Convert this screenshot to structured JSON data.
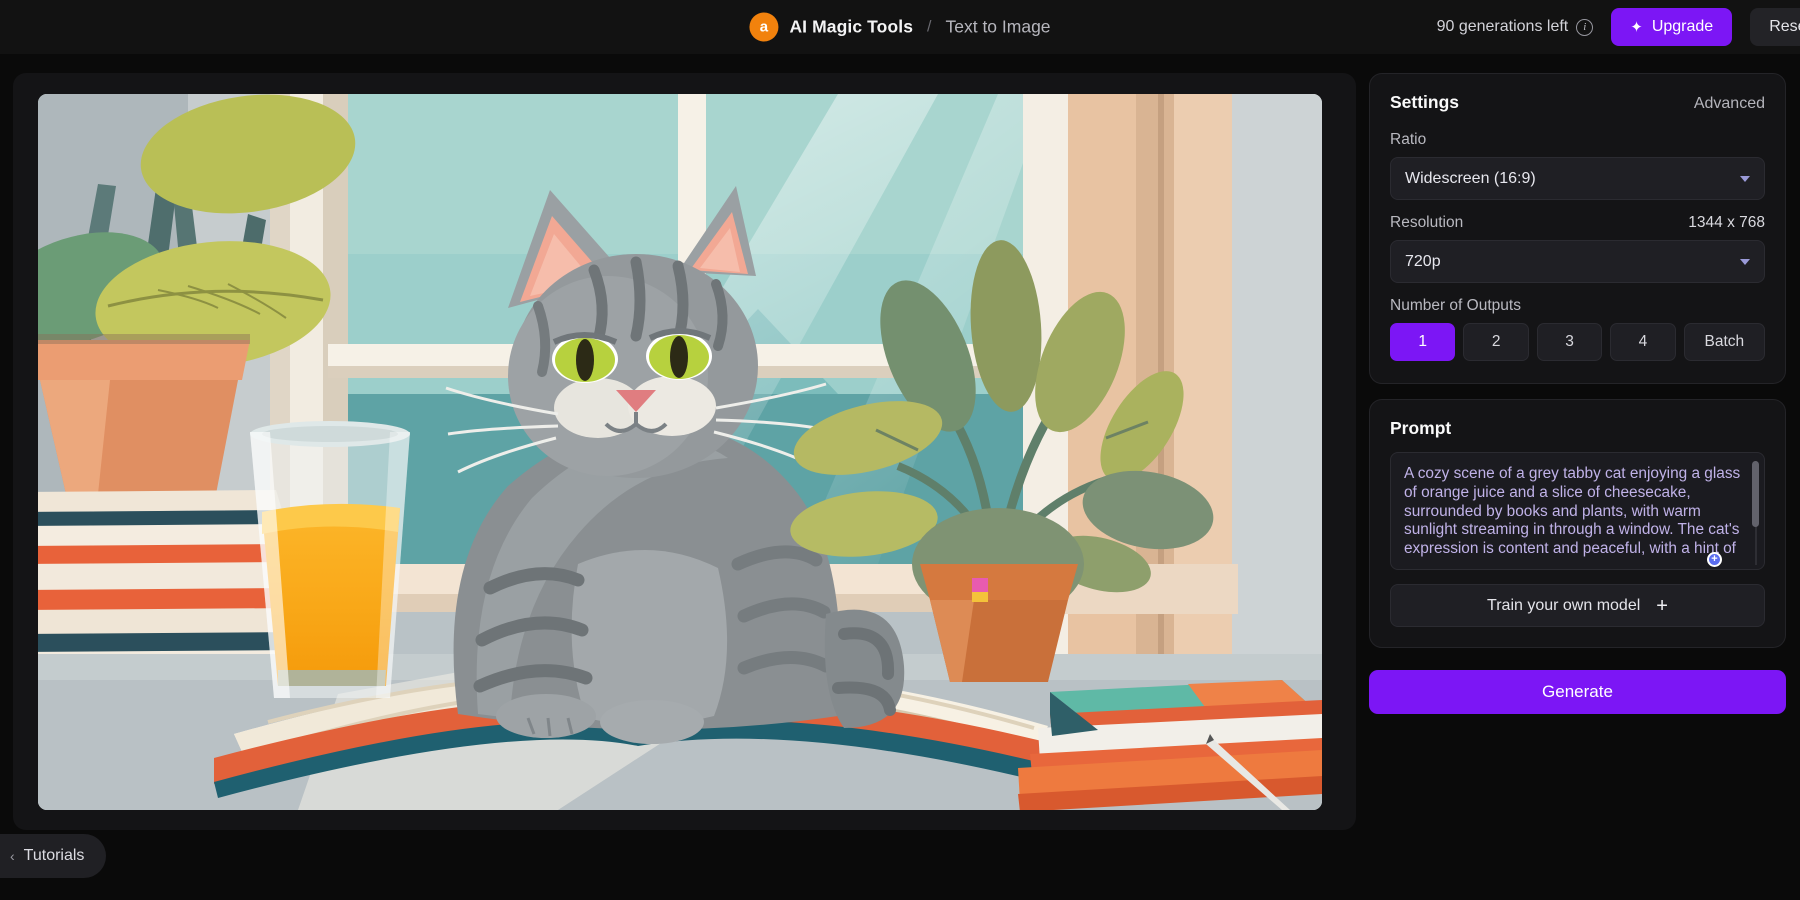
{
  "topbar": {
    "avatar_initial": "a",
    "app_title": "AI Magic Tools",
    "breadcrumb_separator": "/",
    "breadcrumb_current": "Text to Image",
    "generations_left": "90 generations left",
    "info_glyph": "i",
    "upgrade_label": "Upgrade",
    "upgrade_icon": "✦",
    "reset_label": "Reset",
    "accent_color": "#7c16f5",
    "avatar_color": "#f2820d"
  },
  "settings": {
    "title": "Settings",
    "advanced_label": "Advanced",
    "ratio_label": "Ratio",
    "ratio_value": "Widescreen (16:9)",
    "ratio_options": [
      "Widescreen (16:9)"
    ],
    "resolution_label": "Resolution",
    "resolution_dimensions": "1344 x 768",
    "resolution_value": "720p",
    "resolution_options": [
      "720p"
    ],
    "outputs_label": "Number of Outputs",
    "outputs_options": [
      "1",
      "2",
      "3",
      "4",
      "Batch"
    ],
    "outputs_selected": "1"
  },
  "prompt": {
    "title": "Prompt",
    "value": "A cozy scene of a grey tabby cat enjoying a glass of orange juice and a slice of cheesecake, surrounded by books and plants, with warm sunlight streaming in through a window. The cat's expression is content and peaceful, with a hint of",
    "train_model_label": "Train your own model",
    "train_model_icon": "+"
  },
  "actions": {
    "generate_label": "Generate"
  },
  "footer": {
    "tutorials_label": "Tutorials",
    "tutorials_chevron": "‹"
  },
  "canvas": {
    "image_alt": "Illustration of a grey tabby cat on a sunlit windowsill with a glass of orange juice, open book, stacked books and potted plants"
  }
}
